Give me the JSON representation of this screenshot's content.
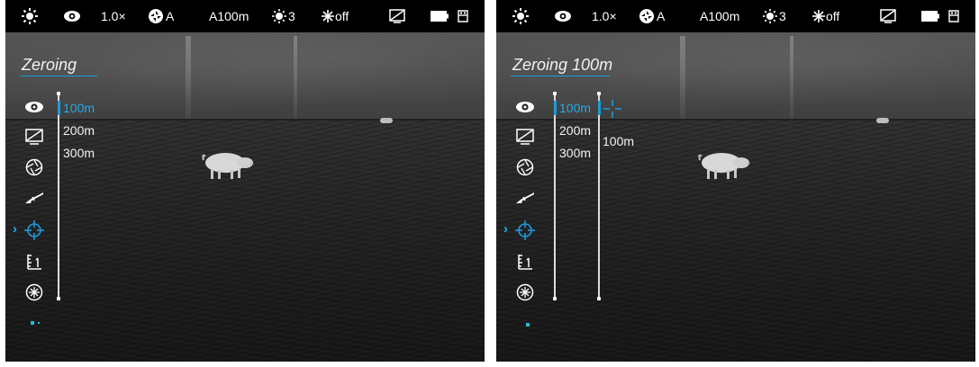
{
  "status_bar": {
    "zoom": "1.0×",
    "calibration": "A",
    "profile": "A100m",
    "brightness": "3",
    "contrast": "off"
  },
  "left_panel": {
    "menu_title": "Zeroing",
    "options": [
      "100m",
      "200m",
      "300m"
    ],
    "selected_option": "100m"
  },
  "right_panel": {
    "menu_title": "Zeroing 100m",
    "options": [
      "100m",
      "200m",
      "300m"
    ],
    "selected_option": "100m",
    "submenu_value": "100m"
  },
  "menu_icons": [
    "eye-icon",
    "display-icon",
    "aperture-icon",
    "rifle-icon",
    "crosshair-icon",
    "ruler-icon",
    "snowflake-icon"
  ],
  "active_menu_icon": "crosshair-icon",
  "colors": {
    "accent": "#1e9ad6",
    "text": "#f2f2f2",
    "statusbar_bg": "#000000"
  }
}
